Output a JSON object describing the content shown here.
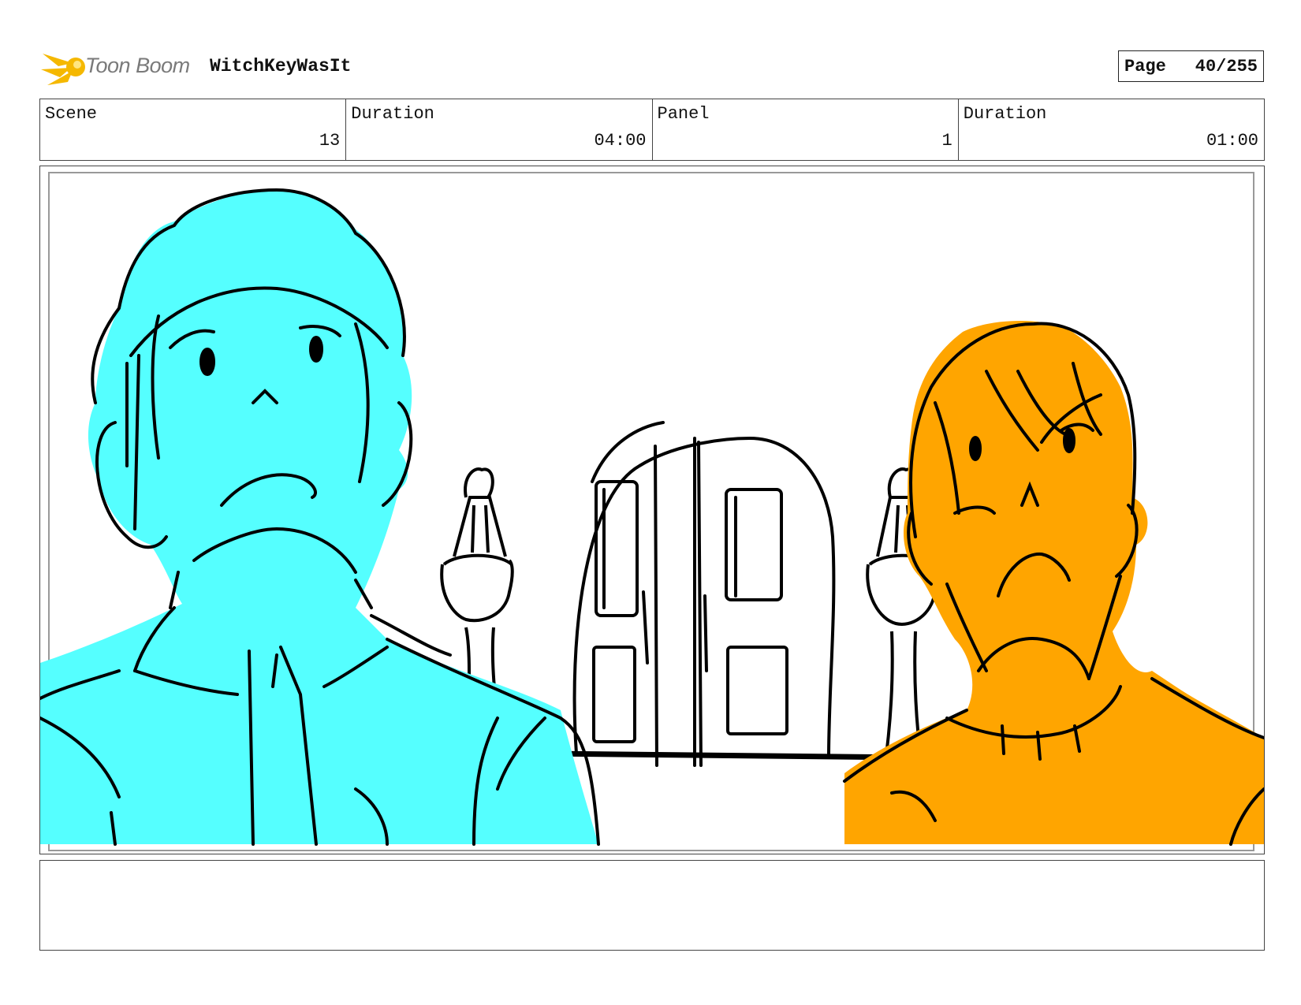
{
  "header": {
    "logo_text": "Toon Boom",
    "project_title": "WitchKeyWasIt",
    "page_label": "Page",
    "page_number": "40/255"
  },
  "info": {
    "scene_label": "Scene",
    "scene_value": "13",
    "scene_duration_label": "Duration",
    "scene_duration_value": "04:00",
    "panel_label": "Panel",
    "panel_value": "1",
    "panel_duration_label": "Duration",
    "panel_duration_value": "01:00"
  },
  "colors": {
    "left_character": "#55ffff",
    "right_character": "#ffa500",
    "logo_star": "#f5b800"
  }
}
